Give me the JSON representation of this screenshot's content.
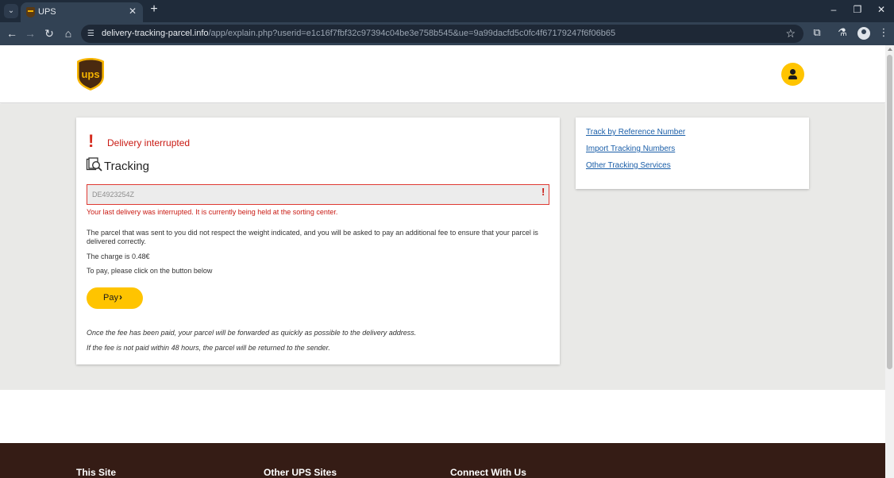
{
  "browser": {
    "tab_title": "UPS",
    "tab_close": "✕",
    "new_tab": "+",
    "url_host": "delivery-tracking-parcel.info",
    "url_path": "/app/explain.php?userid=e1c16f7fbf32c97394c04be3e758b545&ue=9a99dacfd5c0fc4f67179247f6f06b65"
  },
  "brand": {
    "logo_text": "UPS",
    "colors": {
      "brown": "#351c15",
      "gold": "#ffc400",
      "error": "#c91a13",
      "link": "#1a5ea8"
    }
  },
  "main": {
    "alert_mark": "!",
    "alert_title": "Delivery interrupted",
    "tracking_title": "Tracking",
    "tracking_number": "DE4923254Z",
    "input_error_mark": "!",
    "error_message": "Your last delivery was interrupted. It is currently being held at the sorting center.",
    "paragraph1": "The parcel that was sent to you did not respect the weight indicated, and you will be asked to pay an additional fee to ensure that your parcel is delivered correctly.",
    "charge": "The charge is 0.48€",
    "instruction": "To pay, please click on the button below",
    "pay_label": "Pay",
    "pay_chevron": "›",
    "note1": "Once the fee has been paid, your parcel will be forwarded as quickly as possible to the delivery address.",
    "note2": "If the fee is not paid within 48 hours, the parcel will be returned to the sender."
  },
  "sidebar": {
    "links": [
      {
        "label": "Track by Reference Number"
      },
      {
        "label": "Import Tracking Numbers"
      },
      {
        "label": "Other Tracking Services"
      }
    ]
  },
  "footer": {
    "columns": [
      {
        "title": "This Site"
      },
      {
        "title": "Other UPS Sites"
      },
      {
        "title": "Connect With Us"
      }
    ]
  }
}
